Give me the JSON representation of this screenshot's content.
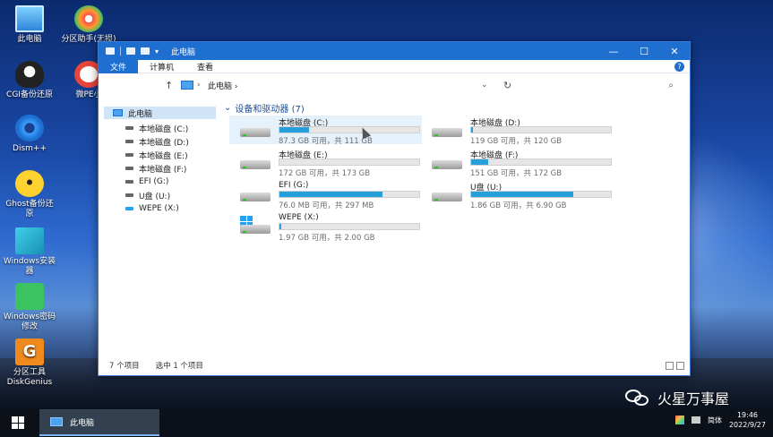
{
  "desktop_icons": [
    {
      "label": "此电脑",
      "icon": "this-pc-icon"
    },
    {
      "label": "分区助手(无损)",
      "icon": "partition-assistant-icon"
    },
    {
      "label": "CGI备份还原",
      "icon": "cgi-backup-icon"
    },
    {
      "label": "微PE小",
      "icon": "wepe-toolbox-icon"
    },
    {
      "label": "Dism++",
      "icon": "dism-icon"
    },
    {
      "label": "Ghost备份还原",
      "icon": "ghost-backup-icon"
    },
    {
      "label": "Windows安装器",
      "icon": "windows-installer-icon"
    },
    {
      "label": "Windows密码修改",
      "icon": "windows-password-icon"
    },
    {
      "label": "分区工具DiskGenius",
      "icon": "diskgenius-icon"
    }
  ],
  "window": {
    "title": "此电脑",
    "controls": {
      "minimize": "—",
      "maximize": "☐",
      "close": "✕"
    },
    "ribbon": {
      "file": "文件",
      "tabs": [
        "计算机",
        "查看"
      ],
      "help": "?"
    },
    "address": {
      "up": "↑",
      "breadcrumb": "此电脑",
      "sep": "›",
      "dropdown": "⌄",
      "refresh": "↻",
      "search": "⌕"
    }
  },
  "nav": {
    "root": "此电脑",
    "drives": [
      "本地磁盘 (C:)",
      "本地磁盘 (D:)",
      "本地磁盘 (E:)",
      "本地磁盘 (F:)",
      "EFI (G:)",
      "U盘 (U:)",
      "WEPE (X:)"
    ]
  },
  "content": {
    "group_title": "设备和驱动器 (7)",
    "group_chevron": "⌄",
    "drives": [
      {
        "name": "本地磁盘 (C:)",
        "info": "87.3 GB 可用，共 111 GB",
        "used_fraction": 0.21,
        "selected": true,
        "kind": "hdd"
      },
      {
        "name": "本地磁盘 (D:)",
        "info": "119 GB 可用，共 120 GB",
        "used_fraction": 0.01,
        "selected": false,
        "kind": "hdd"
      },
      {
        "name": "本地磁盘 (E:)",
        "info": "172 GB 可用，共 173 GB",
        "used_fraction": 0.0,
        "selected": false,
        "kind": "hdd"
      },
      {
        "name": "本地磁盘 (F:)",
        "info": "151 GB 可用，共 172 GB",
        "used_fraction": 0.12,
        "selected": false,
        "kind": "hdd"
      },
      {
        "name": "EFI (G:)",
        "info": "76.0 MB 可用，共 297 MB",
        "used_fraction": 0.74,
        "selected": false,
        "kind": "hdd"
      },
      {
        "name": "U盘 (U:)",
        "info": "1.86 GB 可用，共 6.90 GB",
        "used_fraction": 0.73,
        "selected": false,
        "kind": "hdd"
      },
      {
        "name": "WEPE (X:)",
        "info": "1.97 GB 可用，共 2.00 GB",
        "used_fraction": 0.015,
        "selected": false,
        "kind": "windows"
      }
    ]
  },
  "status": {
    "items": "7 个项目",
    "selected": "选中 1 个项目"
  },
  "taskbar": {
    "task_label": "此电脑",
    "ime": "简体",
    "time": "19:46",
    "date": "2022/9/27"
  },
  "watermark": {
    "text": "火星万事屋"
  }
}
